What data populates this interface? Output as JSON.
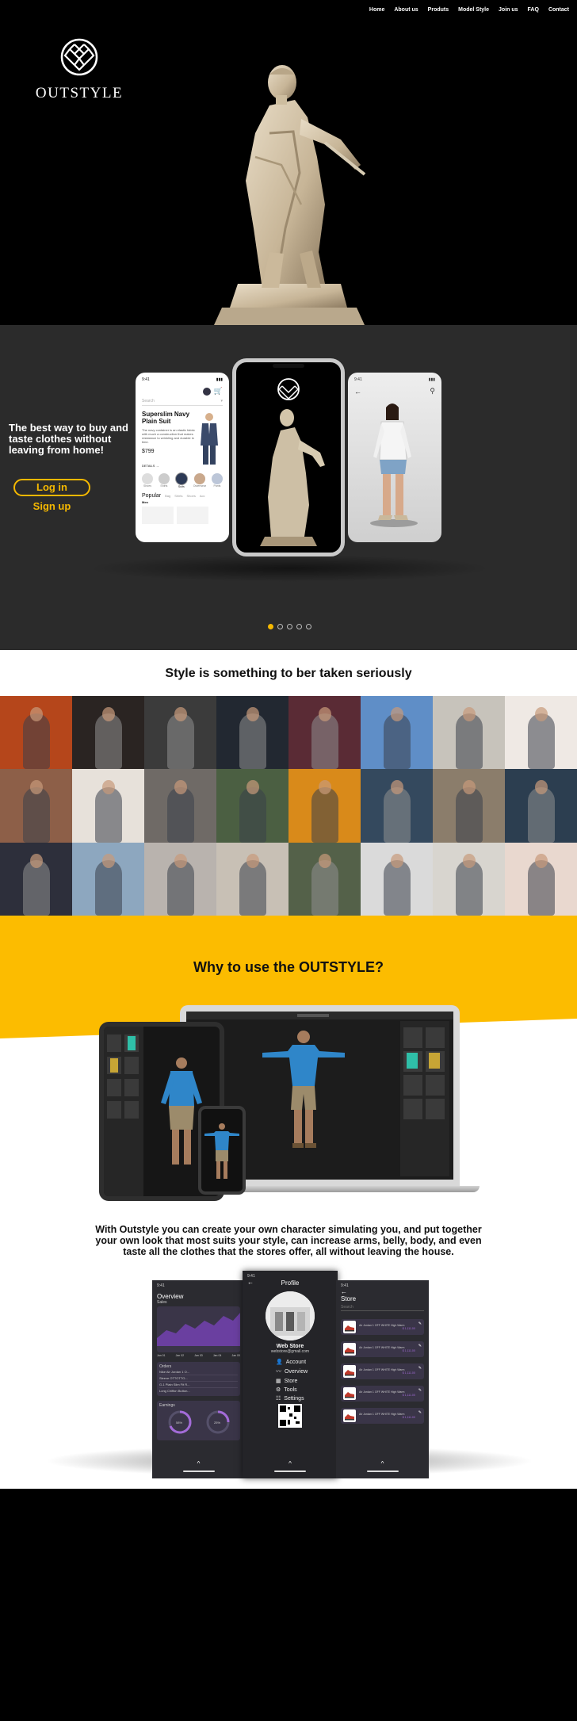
{
  "nav": {
    "items": [
      "Home",
      "About us",
      "Produts",
      "Model Style",
      "Join us",
      "FAQ",
      "Contact"
    ]
  },
  "brand": {
    "name": "OUTSTYLE",
    "logo_icon": "diamond-lattice-icon"
  },
  "showcase": {
    "tagline": "The best way to buy and taste clothes without leaving from home!",
    "login_label": "Log in",
    "signup_label": "Sign up",
    "left_phone": {
      "time": "9:41",
      "search_placeholder": "Search",
      "product_title": "Superslim Navy Plain Suit",
      "product_desc": "The navy container is an elastic fabric with much a construction that makes resistance to wrinkling and durable in time.",
      "price": "$799",
      "details_label": "DETAILS →",
      "categories": [
        "Shoes",
        "Shirts",
        "Suits",
        "Outerwear",
        "Pants"
      ],
      "popular_label": "Popular",
      "tabs": [
        "Bag",
        "Shirts",
        "Shoes",
        "Acc"
      ],
      "section": "Men"
    },
    "right_phone": {
      "time": "9:41"
    },
    "carousel": {
      "count": 5,
      "active": 0
    },
    "colors": {
      "accent": "#f5b800",
      "panel_bg": "#2b2b2b"
    }
  },
  "gallery": {
    "title": "Style is something  to ber taken seriously",
    "tile_colors": [
      "#b5461b",
      "#2a2422",
      "#3b3b3b",
      "#222831",
      "#5a2b35",
      "#5f8ec7",
      "#c7c3bb",
      "#efe9e4",
      "#8d5f48",
      "#e7e1da",
      "#6f6a66",
      "#4b5f42",
      "#d98a1a",
      "#34495e",
      "#8b7d6b",
      "#2c3e50",
      "#2d2f3b",
      "#8da7bf",
      "#b9b3ae",
      "#c8c0b5",
      "#546149",
      "#dadada",
      "#d8d5cf",
      "#e9d8cf"
    ]
  },
  "why": {
    "title": "Why to use the OUTSTYLE?",
    "description": "With Outstyle you can create your own character simulating you, and put together your own look that most suits your style, can increase arms, belly, body, and even taste all the clothes that the stores offer, all without leaving the house.",
    "accent": "#fcbc00"
  },
  "dashboard": {
    "overview": {
      "time": "9:41",
      "title": "Overview",
      "sales_label": "Sales",
      "months": [
        "Jan 01",
        "Jan 02",
        "Jan 03",
        "Jan 04",
        "Jan 05"
      ],
      "orders_label": "Orders",
      "orders": [
        "Nike Air Jordan 1 O...",
        "Sleeve OTTOTTO...",
        "G-1 Plain Slim Fit R...",
        "Long Chiffon Button..."
      ],
      "earnings_label": "Earnings",
      "earnings": [
        "58%",
        "25%"
      ]
    },
    "profile": {
      "time": "9:41",
      "title": "Profile",
      "store_name": "Web Store",
      "email": "webstore@gmail.com",
      "menu": [
        "Account",
        "Overview",
        "Store",
        "Tools",
        "Settings"
      ],
      "menu_icons": [
        "person-icon",
        "trend-icon",
        "store-icon",
        "gear-icon",
        "sliders-icon"
      ]
    },
    "store": {
      "time": "9:41",
      "title": "Store",
      "search_placeholder": "Search",
      "items": [
        {
          "name": "Air Jordan 1 OFF WHITE High Warm",
          "price": "$ 1,111.00"
        },
        {
          "name": "Air Jordan 1 OFF WHITE High Warm",
          "price": "$ 1,111.00"
        },
        {
          "name": "Air Jordan 1 OFF WHITE High Warm",
          "price": "$ 1,111.00"
        },
        {
          "name": "Air Jordan 1 OFF WHITE High Warm",
          "price": "$ 1,111.00"
        },
        {
          "name": "Air Jordan 1 OFF WHITE High Warm",
          "price": "$ 1,111.00"
        }
      ]
    }
  }
}
